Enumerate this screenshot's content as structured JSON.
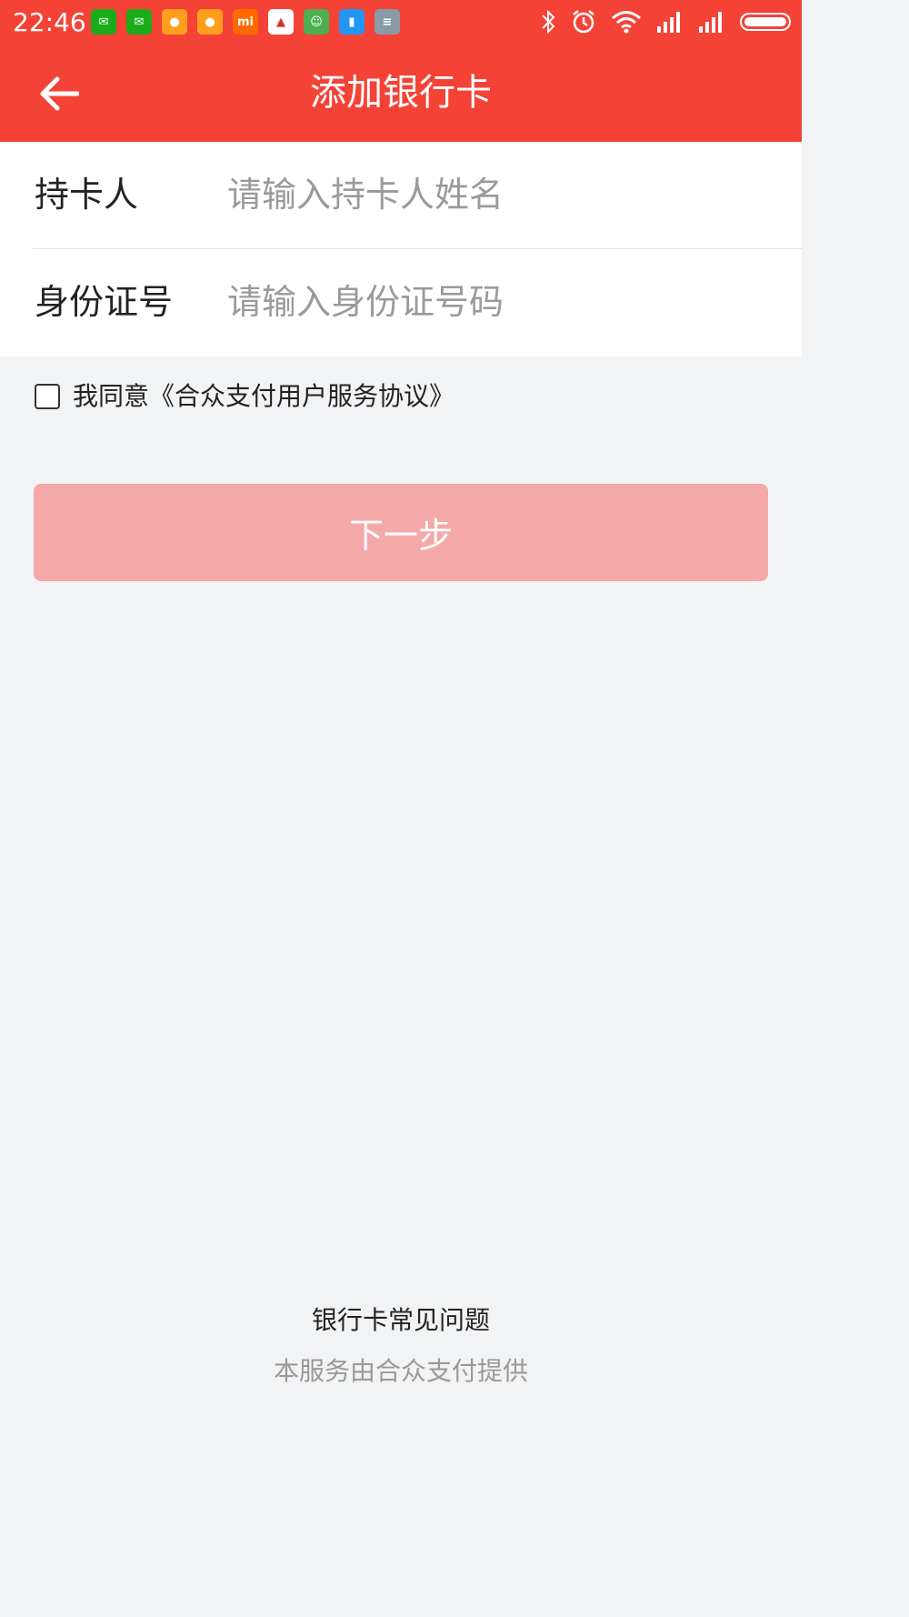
{
  "status_bar": {
    "time": "22:46",
    "notification_icons": [
      {
        "name": "wechat-icon",
        "color": "#1aad19"
      },
      {
        "name": "wechat-icon",
        "color": "#1aad19"
      },
      {
        "name": "message-icon",
        "color": "#ff9f1c"
      },
      {
        "name": "message-icon",
        "color": "#ff9f1c"
      },
      {
        "name": "mi-icon",
        "color": "#ff6900"
      },
      {
        "name": "triangle-app-icon",
        "color": "#ffffff"
      },
      {
        "name": "android-icon",
        "color": "#4caf50"
      },
      {
        "name": "app-icon",
        "color": "#2196f3"
      },
      {
        "name": "storage-icon",
        "color": "#8a9ba8"
      }
    ],
    "system_icons": [
      "bluetooth-icon",
      "alarm-icon",
      "wifi-icon",
      "signal-icon",
      "signal-icon",
      "battery-icon"
    ]
  },
  "header": {
    "title": "添加银行卡",
    "back_icon": "back-arrow-icon"
  },
  "form": {
    "cardholder": {
      "label": "持卡人",
      "placeholder": "请输入持卡人姓名",
      "value": ""
    },
    "id_number": {
      "label": "身份证号",
      "placeholder": "请输入身份证号码",
      "value": ""
    }
  },
  "agreement": {
    "checked": false,
    "text": "我同意《合众支付用户服务协议》"
  },
  "next_button": {
    "label": "下一步"
  },
  "footer": {
    "faq_link": "银行卡常见问题",
    "provided_by": "本服务由合众支付提供"
  },
  "colors": {
    "primary": "#f44236",
    "button_disabled": "#f5a8a8",
    "background": "#f2f3f5"
  }
}
